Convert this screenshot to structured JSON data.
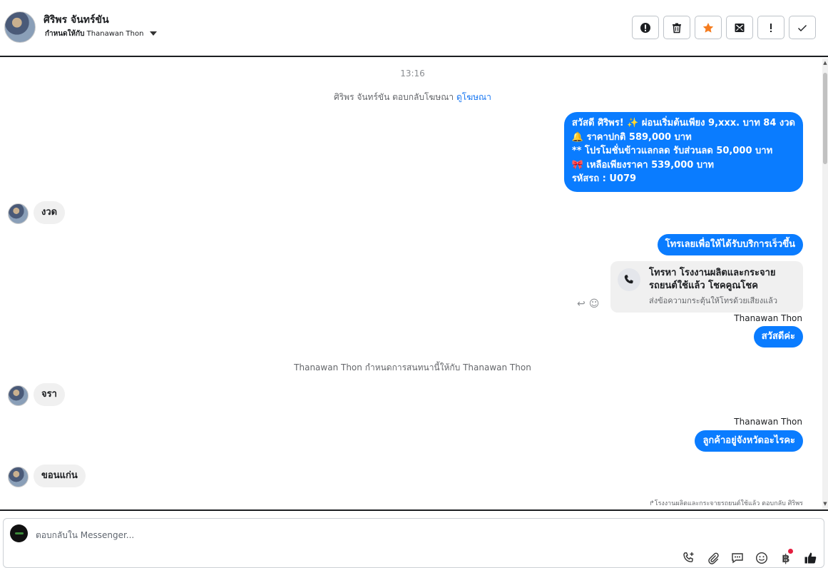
{
  "header": {
    "contact_name": "ศิริพร จันทร์ขัน",
    "assigned_prefix": "กำหนดให้กับ",
    "assigned_to": "Thanawan Thon"
  },
  "toolbar": {
    "icons": [
      "spam-icon",
      "trash-icon",
      "star-icon",
      "mark-unread-icon",
      "follow-up-icon",
      "done-check-icon"
    ],
    "star_color": "#f57c1f"
  },
  "chat": {
    "timestamp": "13:16",
    "system_reply_ad_prefix": "ศิริพร จันทร์ขัน ตอบกลับโฆษณา",
    "system_reply_ad_link": "ดูโฆษณา",
    "ad_message": {
      "line1": "สวัสดี ศิริพร! ✨  ผ่อนเริ่มต้นเพียง 9,xxx. บาท 84 งวด",
      "line2": "🔔 ราคาปกติ 589,000 บาท",
      "line3": "** โปรโมชั่นข้าวแลกลด รับส่วนลด 50,000 บาท",
      "line4": "🎀  เหลือเพียงราคา 539,000 บาท",
      "line5": " รหัสรถ : U079"
    },
    "in_msg_1": "งวด",
    "out_call_prompt": "โทรเลยเพื่อให้ได้รับบริการเร็วขึ้น",
    "call_card": {
      "title": "โทรหา โรงงานผลิตและกระจายรถยนต์ใช้แล้ว โชคคูณโชค",
      "subtitle": "ส่งข้อความกระตุ้นให้โทรด้วยเสียงแล้ว"
    },
    "sender_1": "Thanawan Thon",
    "out_greeting": "สวัสดีค่ะ",
    "system_assign": "Thanawan Thon กำหนดการสนทนานี้ให้กับ Thanawan Thon",
    "in_msg_2": "จรา",
    "sender_2": "Thanawan Thon",
    "out_province": "ลูกค้าอยู่จังหวัดอะไรคะ",
    "in_msg_3": "ขอนแก่น",
    "footnote": "↱โรงงานผลิตและกระจายรถยนต์ใช้แล้ว ตอบกลับ ศิริพร"
  },
  "composer": {
    "placeholder": "ตอบกลับใน Messenger...",
    "icons": [
      "call-add-icon",
      "attachment-icon",
      "saved-reply-icon",
      "emoji-icon",
      "payment-baht-icon",
      "like-icon"
    ],
    "baht_symbol": "฿"
  },
  "colors": {
    "outgoing_bubble": "#0a7cff",
    "incoming_bubble": "#f0f0f0",
    "link": "#1877f2",
    "notif_dot": "#e41e3f"
  }
}
